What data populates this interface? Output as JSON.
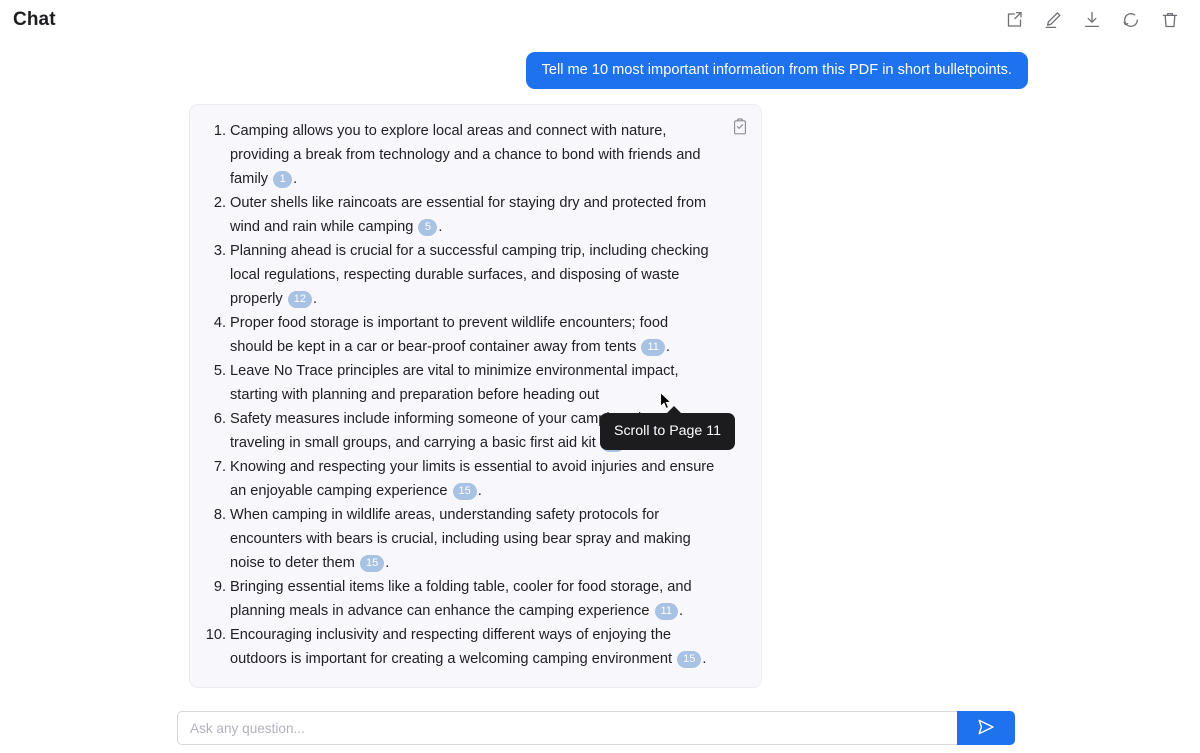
{
  "header": {
    "title": "Chat",
    "actions": [
      {
        "name": "share-icon",
        "label": "Share"
      },
      {
        "name": "edit-icon",
        "label": "Edit"
      },
      {
        "name": "download-icon",
        "label": "Download"
      },
      {
        "name": "refresh-icon",
        "label": "Refresh"
      },
      {
        "name": "trash-icon",
        "label": "Delete"
      }
    ]
  },
  "conversation": {
    "user_message": "Tell me 10 most important information from this PDF in short bulletpoints.",
    "answer": {
      "copy_icon": "clipboard-check-icon",
      "items": [
        {
          "number": "1.",
          "text_before": "Camping allows you to explore local areas and connect with nature, providing a break from technology and a chance to bond with friends and family",
          "citation": "1",
          "text_after": "."
        },
        {
          "number": "2.",
          "text_before": "Outer shells like raincoats are essential for staying dry and protected from wind and rain while camping",
          "citation": "5",
          "text_after": "."
        },
        {
          "number": "3.",
          "text_before": "Planning ahead is crucial for a successful camping trip, including checking local regulations, respecting durable surfaces, and disposing of waste properly",
          "citation": "12",
          "text_after": "."
        },
        {
          "number": "4.",
          "text_before": "Proper food storage is important to prevent wildlife encounters; food should be kept in a car or bear-proof container away from tents",
          "citation": "11",
          "text_after": "."
        },
        {
          "number": "5.",
          "text_before": "Leave No Trace principles are vital to minimize environmental impact, starting with planning and preparation before heading out",
          "citation": "",
          "text_after": ""
        },
        {
          "number": "6.",
          "text_before": "Safety measures include informing someone of your camping plans, traveling in small groups, and carrying a basic first aid kit",
          "citation": "15",
          "text_after": "."
        },
        {
          "number": "7.",
          "text_before": "Knowing and respecting your limits is essential to avoid injuries and ensure an enjoyable camping experience",
          "citation": "15",
          "text_after": "."
        },
        {
          "number": "8.",
          "text_before": "When camping in wildlife areas, understanding safety protocols for encounters with bears is crucial, including using bear spray and making noise to deter them",
          "citation": "15",
          "text_after": "."
        },
        {
          "number": "9.",
          "text_before": "Bringing essential items like a folding table, cooler for food storage, and planning meals in advance can enhance the camping experience",
          "citation": "11",
          "text_after": "."
        },
        {
          "number": "10.",
          "text_before": "Encouraging inclusivity and respecting different ways of enjoying the outdoors is important for creating a welcoming camping environment",
          "citation": "15",
          "text_after": "."
        }
      ]
    }
  },
  "tooltip": {
    "text": "Scroll to Page 11"
  },
  "composer": {
    "placeholder": "Ask any question...",
    "value": "",
    "send_icon": "send-paper-plane-icon"
  },
  "colors": {
    "accent_blue": "#1f72ed",
    "citation_badge": "#a8c2e3",
    "card_background": "#f8f8fc",
    "tooltip_background": "#1c1c1e"
  }
}
